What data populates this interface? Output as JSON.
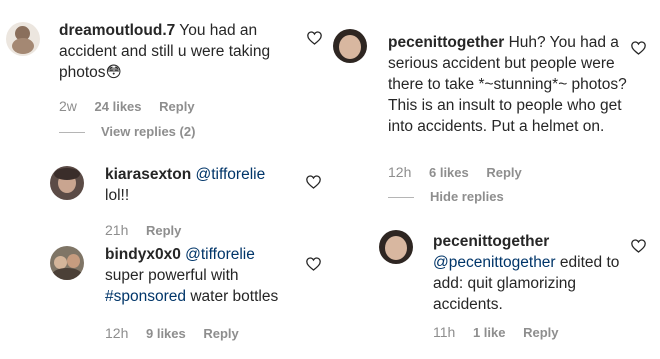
{
  "left_column": {
    "comments": [
      {
        "username": "dreamoutloud.7",
        "text": " You had an accident and still u were taking photos",
        "emoji": "😳",
        "time": "2w",
        "likes": "24 likes",
        "reply": "Reply",
        "view_replies": "View replies (2)"
      },
      {
        "username": "kiarasexton",
        "mention": "@tifforelie",
        "text": "lol!!",
        "time": "21h",
        "reply": "Reply"
      },
      {
        "username": "bindyx0x0",
        "mention": "@tifforelie",
        "text_1": "super powerful with",
        "hashtag": "#sponsored",
        "text_2": " water bottles",
        "time": "12h",
        "likes": "9 likes",
        "reply": "Reply"
      }
    ]
  },
  "right_column": {
    "comments": [
      {
        "username": "pecenittogether",
        "text": " Huh? You had a serious accident but people were there to take *~stunning*~ photos? This is an insult to people who get into accidents. Put a helmet on.",
        "time": "12h",
        "likes": "6 likes",
        "reply": "Reply",
        "hide_replies": "Hide replies"
      },
      {
        "username": "pecenittogether",
        "mention": "@pecenittogether",
        "text": " edited to add: quit glamorizing accidents.",
        "time": "11h",
        "likes": "1 like",
        "reply": "Reply"
      }
    ]
  },
  "colors": {
    "text": "#262626",
    "secondary": "#8e8e8e",
    "link": "#003569"
  }
}
